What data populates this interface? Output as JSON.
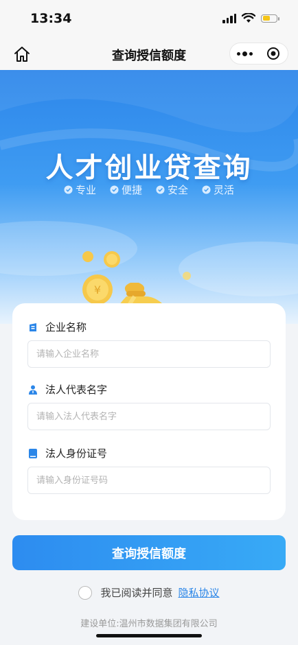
{
  "status_bar": {
    "time": "13:34"
  },
  "nav": {
    "title": "查询授信额度"
  },
  "banner": {
    "title": "人才创业贷查询",
    "features": [
      "专业",
      "便捷",
      "安全",
      "灵活"
    ]
  },
  "form": {
    "company": {
      "label": "企业名称",
      "placeholder": "请输入企业名称",
      "value": ""
    },
    "legal_rep": {
      "label": "法人代表名字",
      "placeholder": "请输入法人代表名字",
      "value": ""
    },
    "id_number": {
      "label": "法人身份证号",
      "placeholder": "请输入身份证号码",
      "value": ""
    }
  },
  "submit_label": "查询授信额度",
  "agreement": {
    "text": "我已阅读并同意",
    "link": "隐私协议",
    "checked": false
  },
  "footer": {
    "builder": "建设单位:温州市数据集团有限公司"
  },
  "colors": {
    "accent": "#2d8cf0",
    "link": "#2b86e8",
    "battery": "#f5c518",
    "label_icon": "#2b86e8"
  },
  "icons": {
    "nav": [
      "home-icon",
      "more-icon",
      "close-target-icon"
    ],
    "status": [
      "signal-icon",
      "wifi-icon",
      "battery-icon"
    ],
    "features": "check-circle-icon",
    "fields": [
      "company-icon",
      "person-icon",
      "id-card-icon"
    ]
  }
}
